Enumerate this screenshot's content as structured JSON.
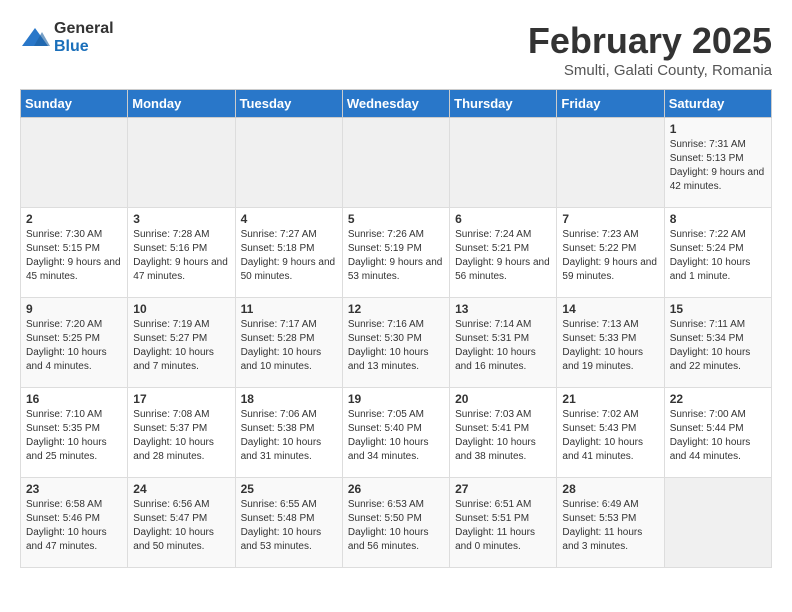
{
  "logo": {
    "general": "General",
    "blue": "Blue"
  },
  "header": {
    "title": "February 2025",
    "subtitle": "Smulti, Galati County, Romania"
  },
  "weekdays": [
    "Sunday",
    "Monday",
    "Tuesday",
    "Wednesday",
    "Thursday",
    "Friday",
    "Saturday"
  ],
  "weeks": [
    [
      {
        "day": "",
        "info": ""
      },
      {
        "day": "",
        "info": ""
      },
      {
        "day": "",
        "info": ""
      },
      {
        "day": "",
        "info": ""
      },
      {
        "day": "",
        "info": ""
      },
      {
        "day": "",
        "info": ""
      },
      {
        "day": "1",
        "info": "Sunrise: 7:31 AM\nSunset: 5:13 PM\nDaylight: 9 hours and 42 minutes."
      }
    ],
    [
      {
        "day": "2",
        "info": "Sunrise: 7:30 AM\nSunset: 5:15 PM\nDaylight: 9 hours and 45 minutes."
      },
      {
        "day": "3",
        "info": "Sunrise: 7:28 AM\nSunset: 5:16 PM\nDaylight: 9 hours and 47 minutes."
      },
      {
        "day": "4",
        "info": "Sunrise: 7:27 AM\nSunset: 5:18 PM\nDaylight: 9 hours and 50 minutes."
      },
      {
        "day": "5",
        "info": "Sunrise: 7:26 AM\nSunset: 5:19 PM\nDaylight: 9 hours and 53 minutes."
      },
      {
        "day": "6",
        "info": "Sunrise: 7:24 AM\nSunset: 5:21 PM\nDaylight: 9 hours and 56 minutes."
      },
      {
        "day": "7",
        "info": "Sunrise: 7:23 AM\nSunset: 5:22 PM\nDaylight: 9 hours and 59 minutes."
      },
      {
        "day": "8",
        "info": "Sunrise: 7:22 AM\nSunset: 5:24 PM\nDaylight: 10 hours and 1 minute."
      }
    ],
    [
      {
        "day": "9",
        "info": "Sunrise: 7:20 AM\nSunset: 5:25 PM\nDaylight: 10 hours and 4 minutes."
      },
      {
        "day": "10",
        "info": "Sunrise: 7:19 AM\nSunset: 5:27 PM\nDaylight: 10 hours and 7 minutes."
      },
      {
        "day": "11",
        "info": "Sunrise: 7:17 AM\nSunset: 5:28 PM\nDaylight: 10 hours and 10 minutes."
      },
      {
        "day": "12",
        "info": "Sunrise: 7:16 AM\nSunset: 5:30 PM\nDaylight: 10 hours and 13 minutes."
      },
      {
        "day": "13",
        "info": "Sunrise: 7:14 AM\nSunset: 5:31 PM\nDaylight: 10 hours and 16 minutes."
      },
      {
        "day": "14",
        "info": "Sunrise: 7:13 AM\nSunset: 5:33 PM\nDaylight: 10 hours and 19 minutes."
      },
      {
        "day": "15",
        "info": "Sunrise: 7:11 AM\nSunset: 5:34 PM\nDaylight: 10 hours and 22 minutes."
      }
    ],
    [
      {
        "day": "16",
        "info": "Sunrise: 7:10 AM\nSunset: 5:35 PM\nDaylight: 10 hours and 25 minutes."
      },
      {
        "day": "17",
        "info": "Sunrise: 7:08 AM\nSunset: 5:37 PM\nDaylight: 10 hours and 28 minutes."
      },
      {
        "day": "18",
        "info": "Sunrise: 7:06 AM\nSunset: 5:38 PM\nDaylight: 10 hours and 31 minutes."
      },
      {
        "day": "19",
        "info": "Sunrise: 7:05 AM\nSunset: 5:40 PM\nDaylight: 10 hours and 34 minutes."
      },
      {
        "day": "20",
        "info": "Sunrise: 7:03 AM\nSunset: 5:41 PM\nDaylight: 10 hours and 38 minutes."
      },
      {
        "day": "21",
        "info": "Sunrise: 7:02 AM\nSunset: 5:43 PM\nDaylight: 10 hours and 41 minutes."
      },
      {
        "day": "22",
        "info": "Sunrise: 7:00 AM\nSunset: 5:44 PM\nDaylight: 10 hours and 44 minutes."
      }
    ],
    [
      {
        "day": "23",
        "info": "Sunrise: 6:58 AM\nSunset: 5:46 PM\nDaylight: 10 hours and 47 minutes."
      },
      {
        "day": "24",
        "info": "Sunrise: 6:56 AM\nSunset: 5:47 PM\nDaylight: 10 hours and 50 minutes."
      },
      {
        "day": "25",
        "info": "Sunrise: 6:55 AM\nSunset: 5:48 PM\nDaylight: 10 hours and 53 minutes."
      },
      {
        "day": "26",
        "info": "Sunrise: 6:53 AM\nSunset: 5:50 PM\nDaylight: 10 hours and 56 minutes."
      },
      {
        "day": "27",
        "info": "Sunrise: 6:51 AM\nSunset: 5:51 PM\nDaylight: 11 hours and 0 minutes."
      },
      {
        "day": "28",
        "info": "Sunrise: 6:49 AM\nSunset: 5:53 PM\nDaylight: 11 hours and 3 minutes."
      },
      {
        "day": "",
        "info": ""
      }
    ]
  ]
}
